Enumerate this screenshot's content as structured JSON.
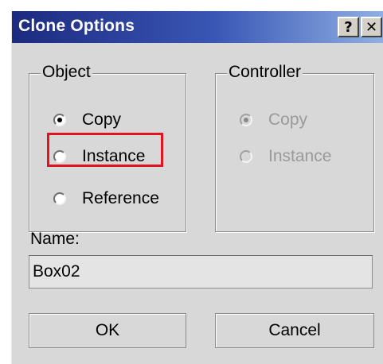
{
  "window": {
    "title": "Clone Options",
    "help_label": "?",
    "close_label": "✕"
  },
  "object_group": {
    "label": "Object",
    "options": [
      {
        "label": "Copy",
        "selected": true
      },
      {
        "label": "Instance",
        "selected": false,
        "highlighted": true
      },
      {
        "label": "Reference",
        "selected": false
      }
    ]
  },
  "controller_group": {
    "label": "Controller",
    "enabled": false,
    "options": [
      {
        "label": "Copy",
        "selected": true
      },
      {
        "label": "Instance",
        "selected": false
      }
    ]
  },
  "name_field": {
    "label": "Name:",
    "value": "Box02"
  },
  "buttons": {
    "ok_label": "OK",
    "cancel_label": "Cancel"
  },
  "colors": {
    "highlight": "#e0141e",
    "titlebar_start": "#1c2a80",
    "titlebar_end": "#8fb0e4"
  }
}
